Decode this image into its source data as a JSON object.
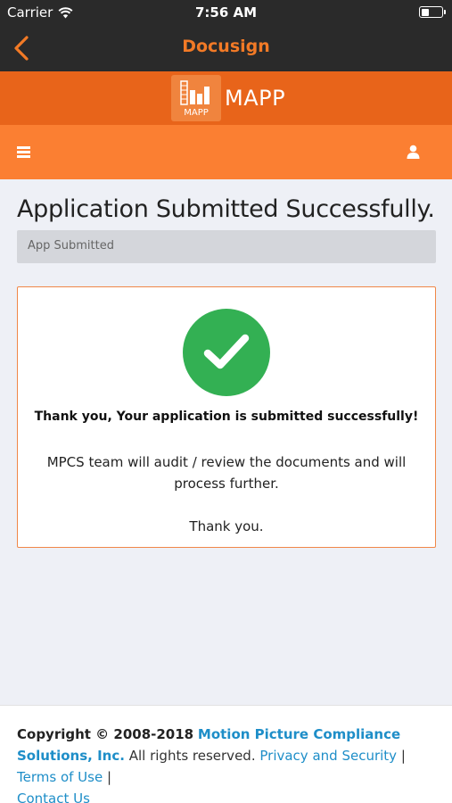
{
  "status_bar": {
    "carrier": "Carrier",
    "time": "7:56 AM",
    "battery_level": 0.4
  },
  "nav": {
    "title": "Docusign"
  },
  "brand": {
    "logo_text": "MAPP",
    "name": "MAPP"
  },
  "page": {
    "title": "Application Submitted Successfully.",
    "breadcrumb": "App Submitted"
  },
  "card": {
    "headline": "Thank you, Your application is submitted successfully!",
    "message": "MPCS team will audit / review the documents and will process further.",
    "closing": "Thank you."
  },
  "footer": {
    "copyright": "Copyright © 2008-2018",
    "company": "Motion Picture Compliance Solutions, Inc.",
    "rights": "All rights reserved.",
    "privacy_link": "Privacy and Security",
    "terms_link": "Terms of Use",
    "separator": "|",
    "contact_link": "Contact Us"
  },
  "colors": {
    "accent_orange": "#fb7f32",
    "brand_orange": "#e8641a",
    "nav_dark": "#2a2a2a",
    "success_green": "#33b053",
    "link_blue": "#1e8ec8"
  },
  "icons": [
    "wifi-icon",
    "battery-icon",
    "back-chevron-icon",
    "mapp-logo-icon",
    "hamburger-menu-icon",
    "user-icon",
    "checkmark-icon"
  ]
}
